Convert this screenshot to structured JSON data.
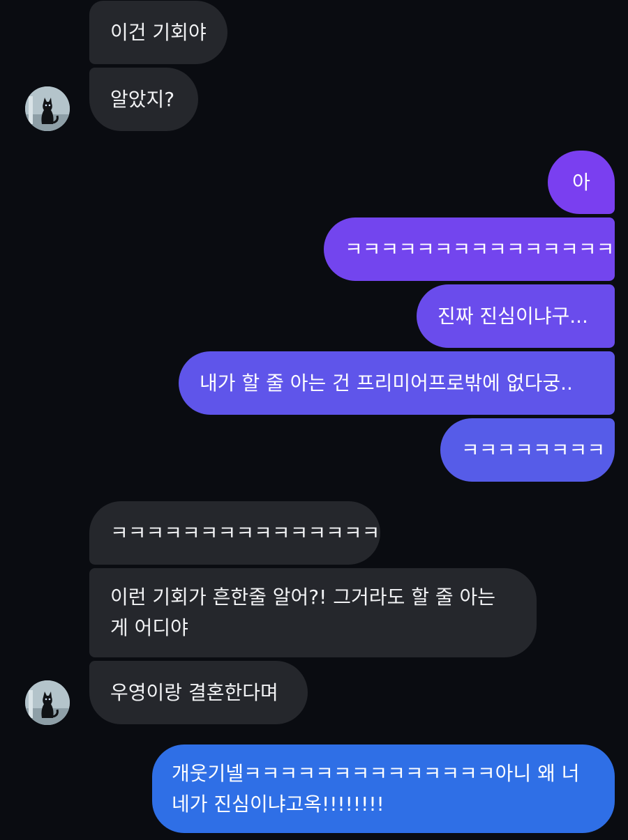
{
  "messages": [
    {
      "sender": "other",
      "text": "이건 기회야"
    },
    {
      "sender": "other",
      "text": "알았지?"
    },
    {
      "sender": "me",
      "text": "아"
    },
    {
      "sender": "me",
      "text": "ㅋㅋㅋㅋㅋㅋㅋㅋㅋㅋㅋㅋㅋㅋㅋ"
    },
    {
      "sender": "me",
      "text": "진짜 진심이냐구..."
    },
    {
      "sender": "me",
      "text": "내가 할 줄 아는 건 프리미어프로밖에 없다궁.."
    },
    {
      "sender": "me",
      "text": "ㅋㅋㅋㅋㅋㅋㅋㅋ"
    },
    {
      "sender": "other",
      "text": "ㅋㅋㅋㅋㅋㅋㅋㅋㅋㅋㅋㅋㅋㅋㅋ"
    },
    {
      "sender": "other",
      "text": "이런 기회가 흔한줄 알어?! 그거라도 할 줄 아는 게 어디야"
    },
    {
      "sender": "other",
      "text": "우영이랑 결혼한다며"
    },
    {
      "sender": "me",
      "text": "개웃기넬ㅋㅋㅋㅋㅋㅋㅋㅋㅋㅋㅋㅋㅋㅋ아니 왜 너네가 진심이냐고옥!!!!!!!!"
    }
  ],
  "avatar": {
    "icon": "black-cat-avatar-icon"
  },
  "colors": {
    "background": "#0a0c11",
    "received_bubble": "#25272c",
    "sent_gradient_top": "#7a3ff0",
    "sent_gradient_bottom": "#2f6fe6"
  }
}
